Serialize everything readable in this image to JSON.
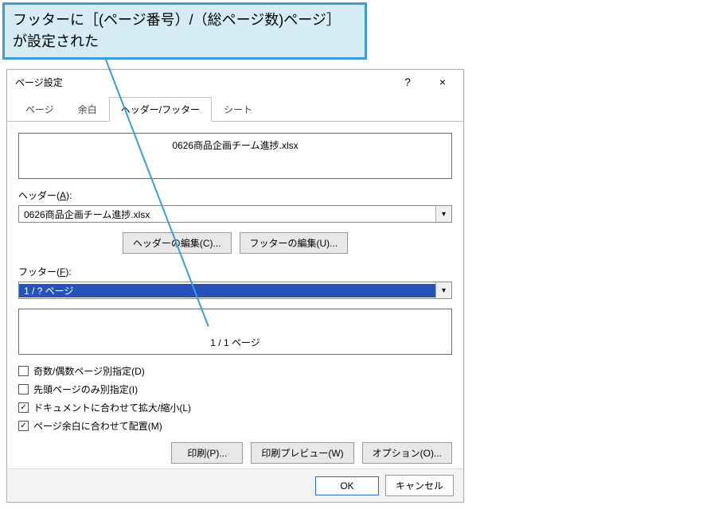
{
  "callout": {
    "line1": "フッターに［(ページ番号）/（総ページ数)ページ］",
    "line2": "が設定された"
  },
  "dialog": {
    "title": "ページ設定",
    "help": "?",
    "close": "×",
    "tabs": {
      "page": "ページ",
      "margin": "余白",
      "headerfooter": "ヘッダー/フッター",
      "sheet": "シート"
    },
    "header_preview": "0626商品企画チーム進捗.xlsx",
    "header_label": "ヘッダー(",
    "header_accel": "A",
    "header_label2": "):",
    "header_value": "0626商品企画チーム進捗.xlsx",
    "edit_header_btn": "ヘッダーの編集(C)...",
    "edit_footer_btn": "フッターの編集(U)...",
    "footer_label": "フッター(",
    "footer_accel": "F",
    "footer_label2": "):",
    "footer_value": "1 / ? ページ",
    "footer_preview": "1 / 1 ページ",
    "checks": {
      "oddeven": "奇数/偶数ページ別指定(D)",
      "firstpage": "先頭ページのみ別指定(I)",
      "scaledoc": "ドキュメントに合わせて拡大/縮小(L)",
      "alignmargin": "ページ余白に合わせて配置(M)"
    },
    "check_states": {
      "oddeven": false,
      "firstpage": false,
      "scaledoc": true,
      "alignmargin": true
    },
    "print_btn": "印刷(P)...",
    "preview_btn": "印刷プレビュー(W)",
    "options_btn": "オプション(O)...",
    "ok": "OK",
    "cancel": "キャンセル"
  }
}
